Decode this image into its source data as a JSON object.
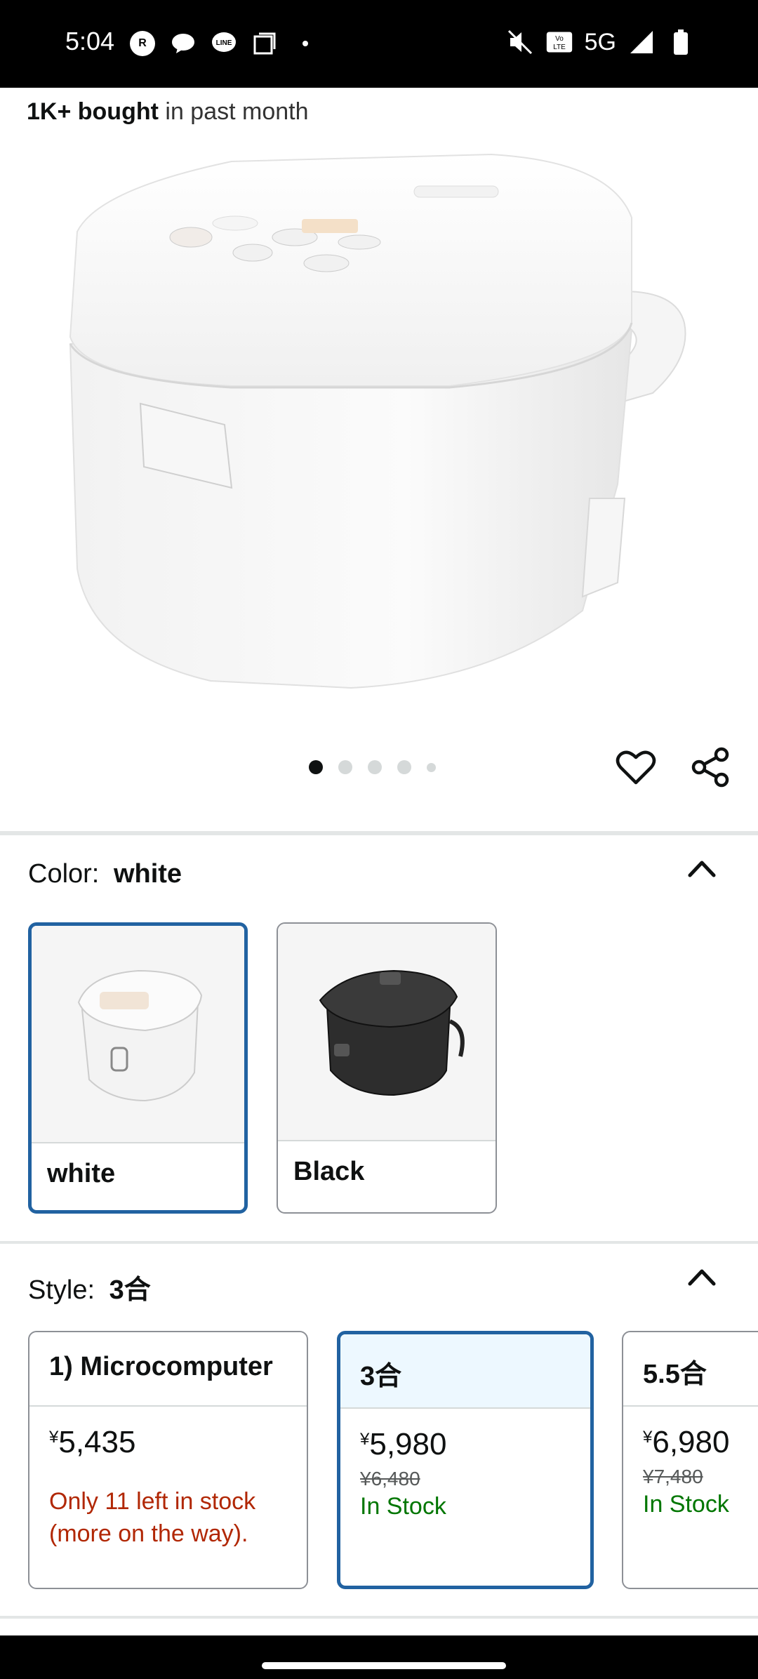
{
  "status_bar": {
    "time": "5:04",
    "network": "5G",
    "left_icons": [
      "rakuten-link-icon",
      "chat-bubble-icon",
      "line-icon",
      "screenshot-icon",
      "dot-icon"
    ],
    "right_icons": [
      "mute-icon",
      "volte-icon",
      "signal-icon",
      "battery-icon"
    ]
  },
  "bought": {
    "count": "1K+ bought",
    "suffix": " in past month"
  },
  "carousel": {
    "total": 5,
    "active_index": 0
  },
  "color": {
    "label": "Color:",
    "selected": "white",
    "options": [
      {
        "name": "white",
        "selected": true
      },
      {
        "name": "Black",
        "selected": false
      }
    ]
  },
  "style": {
    "label": "Style:",
    "selected": "3合",
    "options": [
      {
        "name": "1) Microcomputer",
        "currency": "¥",
        "price": "5,435",
        "list_price": "",
        "stock": "Only 11 left in stock (more on the way).",
        "stock_type": "low",
        "selected": false
      },
      {
        "name": "3合",
        "currency": "¥",
        "price": "5,980",
        "list_price": "¥6,480",
        "stock": "In Stock",
        "stock_type": "in",
        "selected": true
      },
      {
        "name": "5.5合",
        "currency": "¥",
        "price": "6,980",
        "list_price": "¥7,480",
        "stock": "In Stock",
        "stock_type": "in",
        "selected": false
      }
    ]
  },
  "colors": {
    "accent": "#2162a1",
    "in_stock": "#007600",
    "low_stock": "#b12704",
    "selected_bg": "#edf8ff"
  }
}
